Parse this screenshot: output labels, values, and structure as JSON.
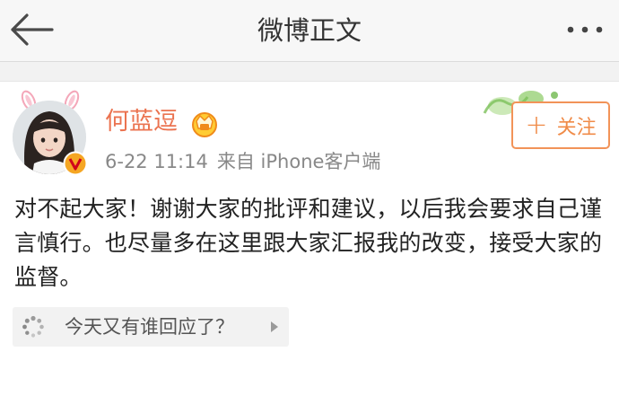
{
  "header": {
    "title": "微博正文"
  },
  "post": {
    "author": "何蓝逗",
    "time": "6-22 11:14",
    "source": "来自 iPhone客户端",
    "text": "对不起大家！谢谢大家的批评和建议，以后我会要求自己谨言慎行。也尽量多在这里跟大家汇报我的改变，接受大家的监督。",
    "follow_label": "关注",
    "follow_plus": "+"
  },
  "reply": {
    "prompt": "今天又有谁回应了？"
  },
  "icons": {
    "back": "arrow-left-icon",
    "more": "more-dots-icon",
    "verified": "verified-v-icon",
    "vip": "vip-crown-icon",
    "reply": "loading-dots-icon",
    "arrow": "triangle-right-icon"
  },
  "colors": {
    "accent": "#eb7350",
    "follow_border": "#f29358",
    "verified_bg": "#f5a623"
  }
}
